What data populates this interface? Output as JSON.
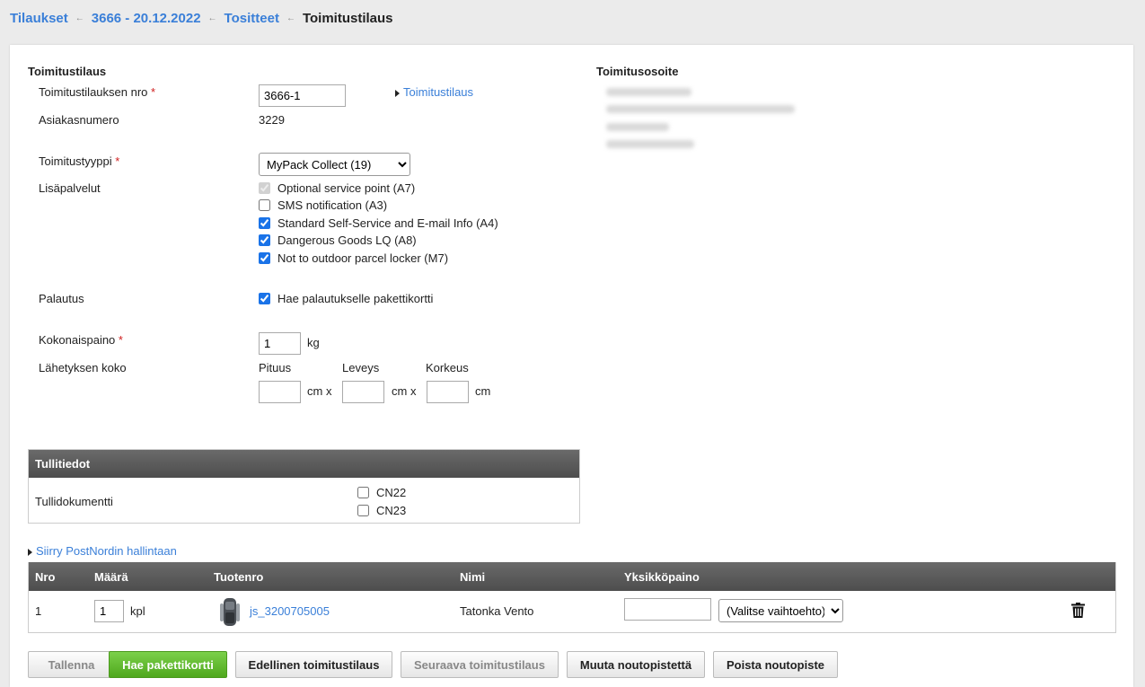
{
  "breadcrumb": {
    "items": [
      "Tilaukset",
      "3666 - 20.12.2022",
      "Tositteet"
    ],
    "current": "Toimitustilaus"
  },
  "form": {
    "section_title": "Toimitustilaus",
    "order_no_label": "Toimitustilauksen nro",
    "required_mark": "*",
    "order_no_value": "3666-1",
    "order_link": "Toimitustilaus",
    "customer_no_label": "Asiakasnumero",
    "customer_no_value": "3229",
    "delivery_type_label": "Toimitustyyppi",
    "delivery_type_value": "MyPack Collect (19)",
    "extra_services_label": "Lisäpalvelut",
    "extra_services": [
      {
        "label": "Optional service point (A7)",
        "checked": true,
        "disabled": true
      },
      {
        "label": "SMS notification (A3)",
        "checked": false,
        "disabled": false
      },
      {
        "label": "Standard Self-Service and E-mail Info (A4)",
        "checked": true,
        "disabled": false
      },
      {
        "label": "Dangerous Goods LQ (A8)",
        "checked": true,
        "disabled": false
      },
      {
        "label": "Not to outdoor parcel locker (M7)",
        "checked": true,
        "disabled": false
      }
    ],
    "return_label": "Palautus",
    "return_option": "Hae palautukselle pakettikortti",
    "weight_label": "Kokonaispaino",
    "weight_value": "1",
    "weight_unit": "kg",
    "size_label": "Lähetyksen koko",
    "length_label": "Pituus",
    "width_label": "Leveys",
    "height_label": "Korkeus",
    "cm_x": "cm x",
    "cm": "cm"
  },
  "address": {
    "title": "Toimitusosoite"
  },
  "customs": {
    "title": "Tullitiedot",
    "doc_label": "Tullidokumentti",
    "options": [
      "CN22",
      "CN23"
    ]
  },
  "postnord_link": "Siirry PostNordin hallintaan",
  "items_table": {
    "headers": [
      "Nro",
      "Määrä",
      "Tuotenro",
      "Nimi",
      "Yksikköpaino"
    ],
    "rows": [
      {
        "nro": "1",
        "qty": "1",
        "unit": "kpl",
        "product_no": "js_3200705005",
        "name": "Tatonka Vento",
        "weight": "",
        "weight_option": "(Valitse vaihtoehto)"
      }
    ]
  },
  "buttons": {
    "save": "Tallenna",
    "get_card": "Hae pakettikortti",
    "prev": "Edellinen toimitustilaus",
    "next": "Seuraava toimitustilaus",
    "change_pickup": "Muuta noutopistettä",
    "delete_pickup": "Poista noutopiste"
  }
}
